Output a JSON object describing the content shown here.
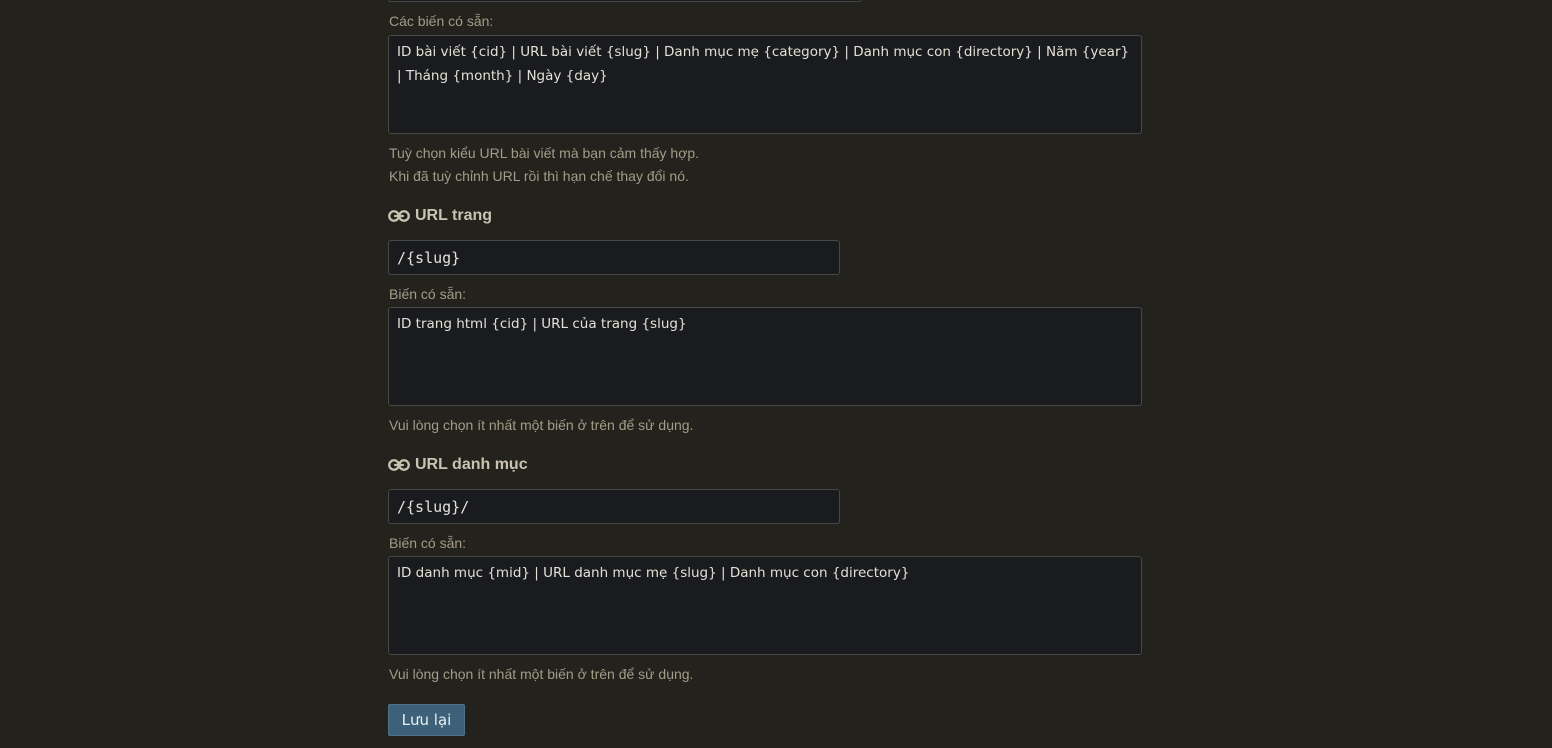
{
  "post_url": {
    "available_vars_label": "Các biến có sẵn:",
    "available_vars_text": "ID bài viết {cid} | URL bài viết {slug} | Danh mục mẹ {category} | Danh mục con {directory} | Năm {year} | Tháng {month} | Ngày {day}",
    "help_line_1": "Tuỳ chọn kiểu URL bài viết mà bạn cảm thấy hợp.",
    "help_line_2": "Khi đã tuỳ chỉnh URL rồi thì hạn chế thay đổi nó."
  },
  "page_url": {
    "heading": "URL trang",
    "heading_icon": "link-icon",
    "value": "/{slug}",
    "available_vars_label": "Biến có sẵn:",
    "available_vars_text": "ID trang html {cid} | URL của trang {slug}",
    "help": "Vui lòng chọn ít nhất một biến ở trên để sử dụng."
  },
  "category_url": {
    "heading": "URL danh mục",
    "heading_icon": "link-icon",
    "value": "/{slug}/",
    "available_vars_label": "Biến có sẵn:",
    "available_vars_text": "ID danh mục {mid} | URL danh mục mẹ {slug} | Danh mục con {directory}",
    "help": "Vui lòng chọn ít nhất một biến ở trên để sử dụng."
  },
  "save_button_label": "Lưu lại",
  "colors": {
    "background": "#23221c",
    "field_background": "#1a1b1e",
    "muted_text": "#a49c88",
    "heading_text": "#c9c3b2",
    "button": "#3c6178"
  }
}
